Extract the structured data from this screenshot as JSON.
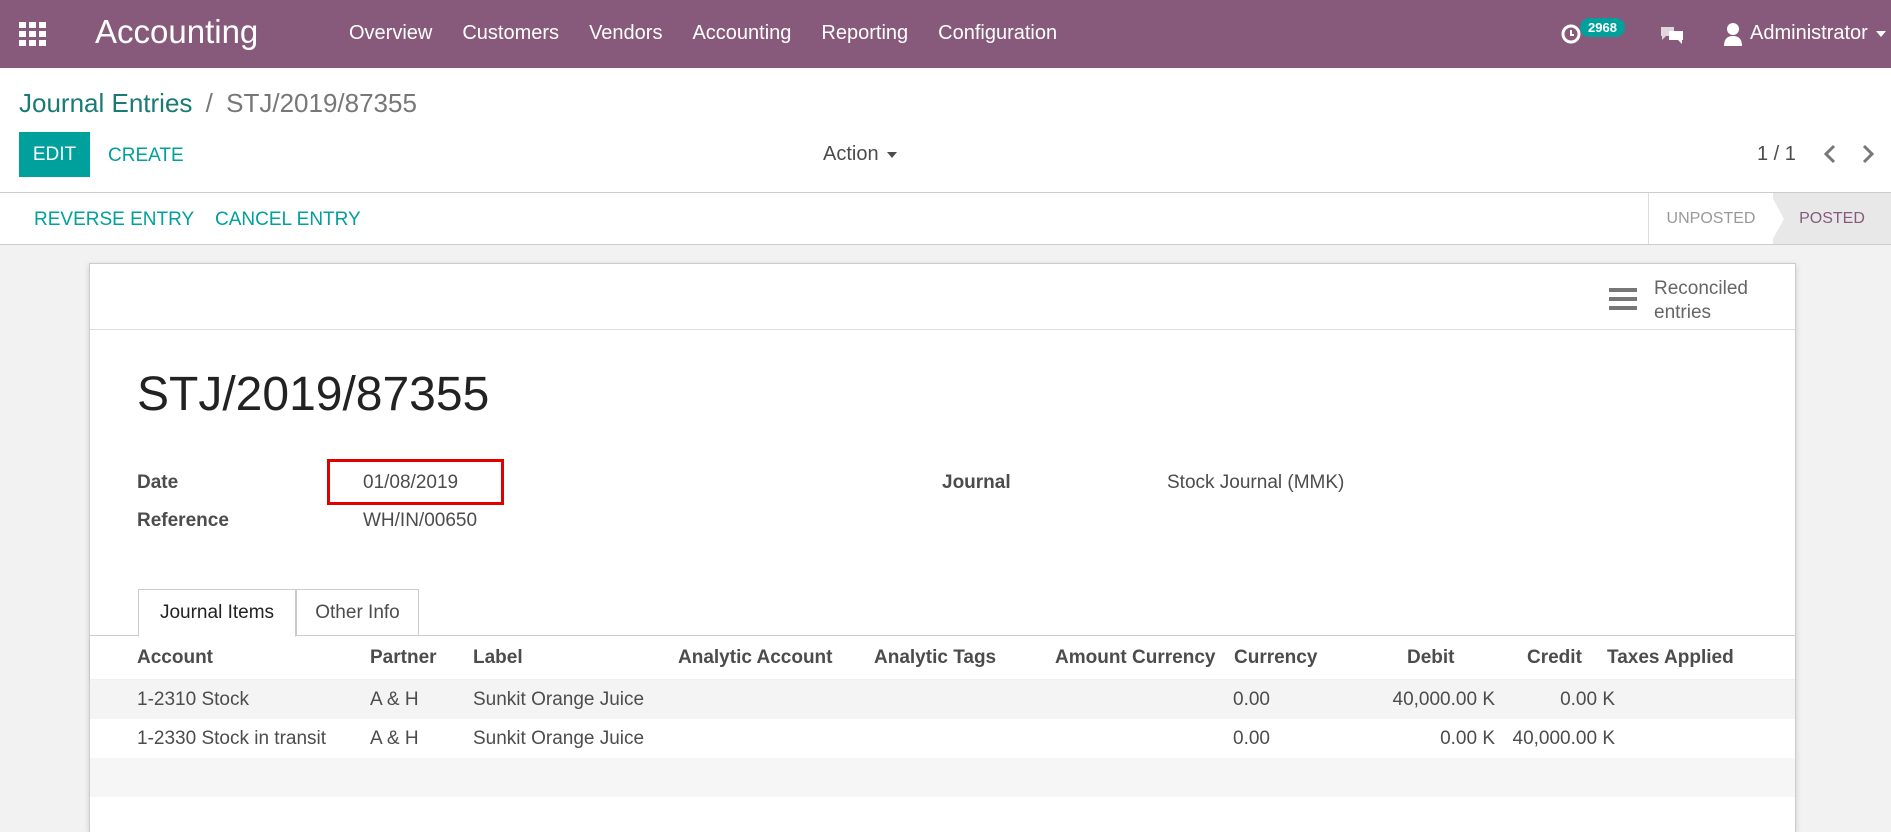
{
  "navbar": {
    "brand": "Accounting",
    "menu": [
      "Overview",
      "Customers",
      "Vendors",
      "Accounting",
      "Reporting",
      "Configuration"
    ],
    "activity_count": "2968",
    "user": "Administrator"
  },
  "breadcrumb": {
    "parent": "Journal Entries",
    "separator": "/",
    "current": "STJ/2019/87355"
  },
  "buttons": {
    "edit": "EDIT",
    "create": "CREATE",
    "action": "Action"
  },
  "pager": {
    "value": "1 / 1"
  },
  "statusbar": {
    "reverse": "REVERSE ENTRY",
    "cancel": "CANCEL ENTRY",
    "stages": [
      "UNPOSTED",
      "POSTED"
    ],
    "current_stage": "POSTED"
  },
  "smart_button": {
    "line1": "Reconciled",
    "line2": "entries"
  },
  "form": {
    "title": "STJ/2019/87355",
    "date_label": "Date",
    "date_value": "01/08/2019",
    "reference_label": "Reference",
    "reference_value": "WH/IN/00650",
    "journal_label": "Journal",
    "journal_value": "Stock Journal (MMK)"
  },
  "tabs": [
    "Journal Items",
    "Other Info"
  ],
  "table": {
    "columns": [
      "Account",
      "Partner",
      "Label",
      "Analytic Account",
      "Analytic Tags",
      "Amount Currency",
      "Currency",
      "Debit",
      "Credit",
      "Taxes Applied"
    ],
    "rows": [
      {
        "account": "1-2310 Stock",
        "partner": "A & H",
        "label": "Sunkit Orange Juice",
        "amount_currency": "0.00",
        "debit": "40,000.00 K",
        "credit": "0.00 K"
      },
      {
        "account": "1-2330 Stock in transit",
        "partner": "A & H",
        "label": "Sunkit Orange Juice",
        "amount_currency": "0.00",
        "debit": "0.00 K",
        "credit": "40,000.00 K"
      }
    ]
  },
  "colors": {
    "navbar": "#875a7b",
    "primary": "#00a09d",
    "highlight": "#e00000"
  }
}
